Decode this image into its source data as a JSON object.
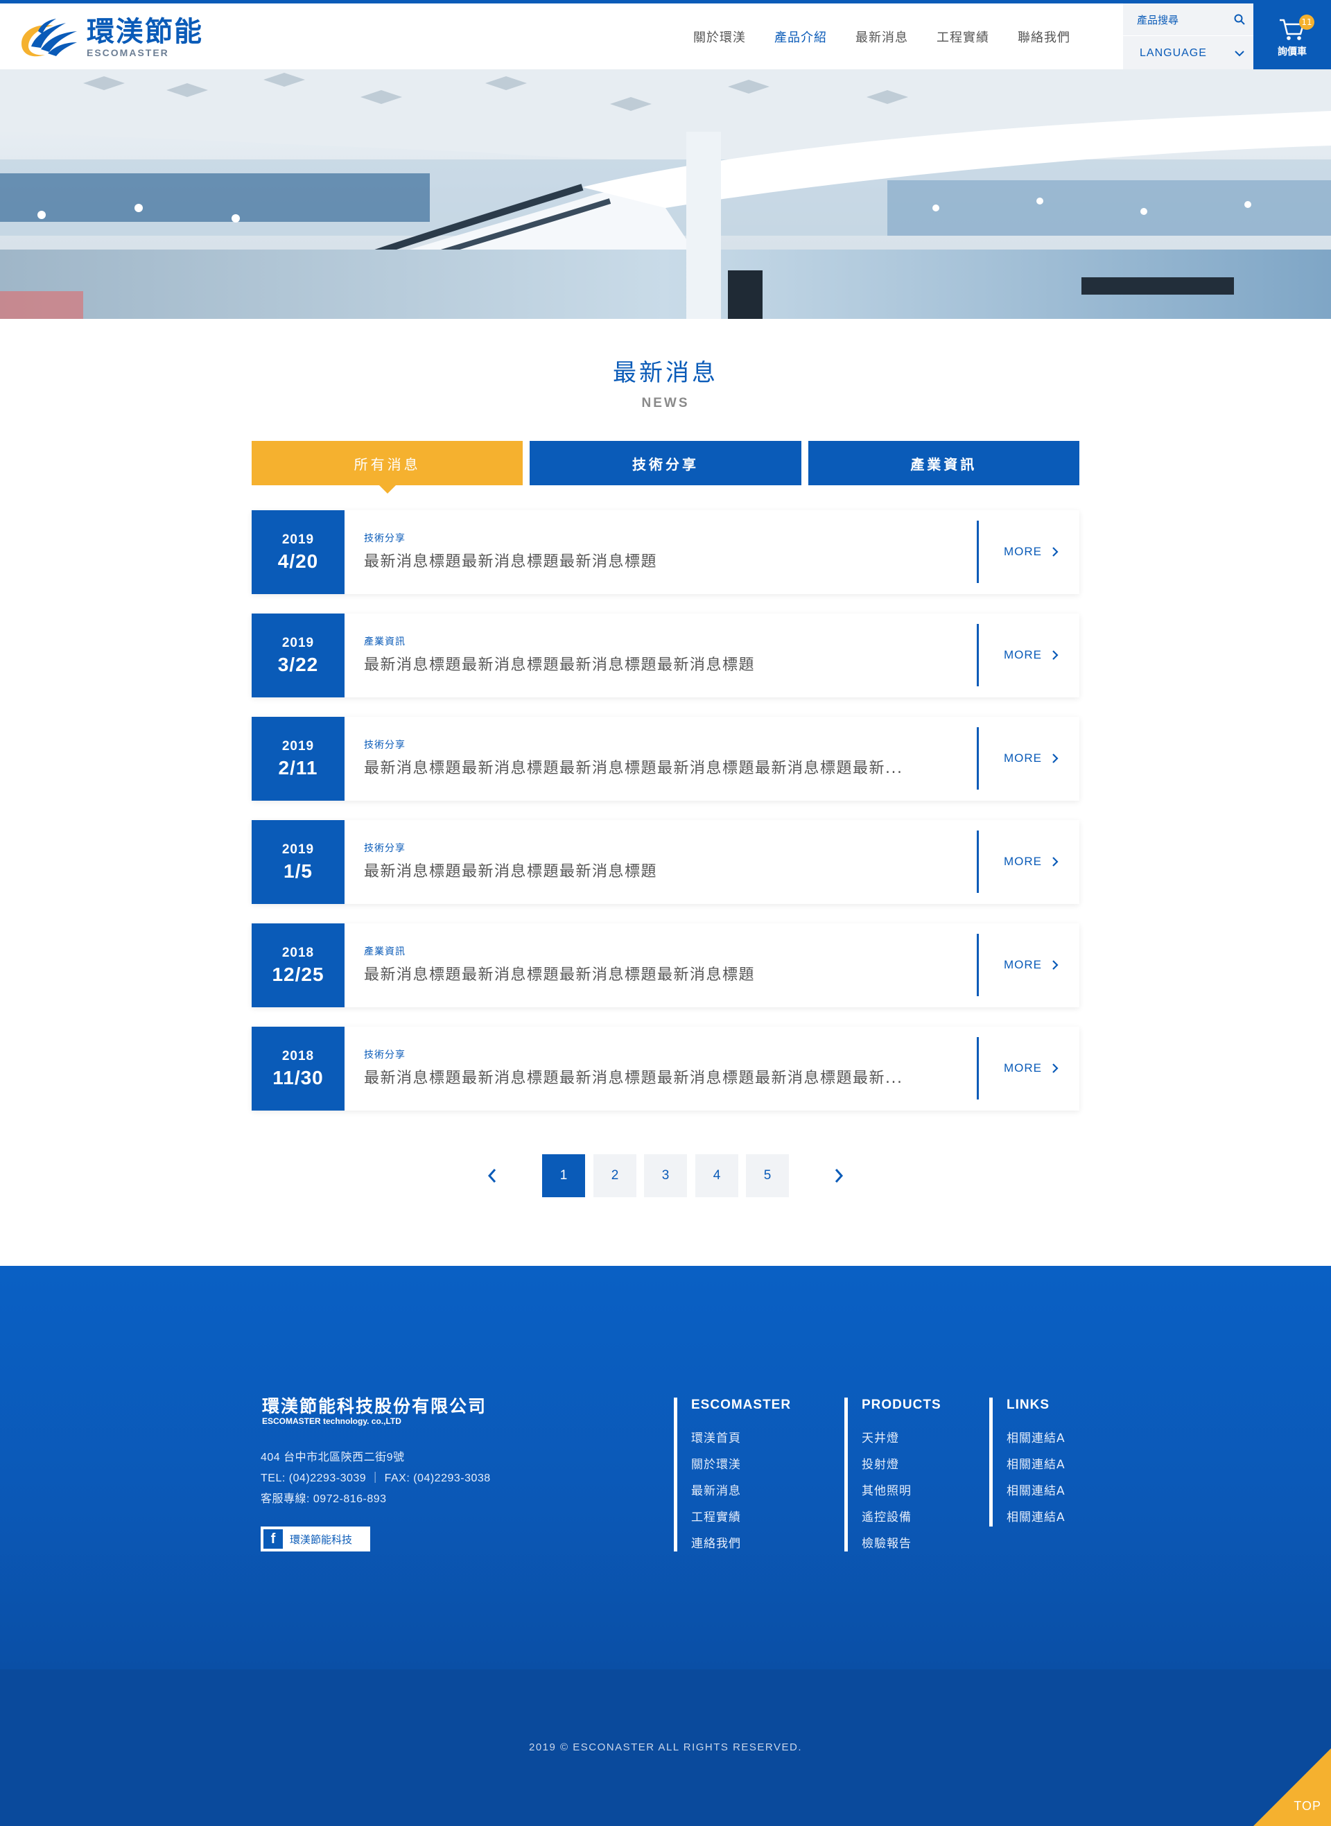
{
  "header": {
    "logo_cn": "環渼節能",
    "logo_en": "ESCOMASTER",
    "nav": [
      {
        "label": "關於環渼",
        "active": false
      },
      {
        "label": "產品介紹",
        "active": true
      },
      {
        "label": "最新消息",
        "active": false
      },
      {
        "label": "工程實績",
        "active": false
      },
      {
        "label": "聯絡我們",
        "active": false
      }
    ],
    "search_label": "產品搜尋",
    "language_label": "LANGUAGE",
    "cart_count": "11",
    "cart_label": "詢價車"
  },
  "section": {
    "title_cn": "最新消息",
    "title_en": "NEWS"
  },
  "tabs": [
    {
      "label": "所有消息",
      "active": true
    },
    {
      "label": "技術分享",
      "active": false
    },
    {
      "label": "產業資訊",
      "active": false
    }
  ],
  "news": [
    {
      "year": "2019",
      "md": "4/20",
      "category": "技術分享",
      "title": "最新消息標題最新消息標題最新消息標題",
      "more": "MORE"
    },
    {
      "year": "2019",
      "md": "3/22",
      "category": "產業資訊",
      "title": "最新消息標題最新消息標題最新消息標題最新消息標題",
      "more": "MORE"
    },
    {
      "year": "2019",
      "md": "2/11",
      "category": "技術分享",
      "title": "最新消息標題最新消息標題最新消息標題最新消息標題最新消息標題最新...",
      "more": "MORE"
    },
    {
      "year": "2019",
      "md": "1/5",
      "category": "技術分享",
      "title": "最新消息標題最新消息標題最新消息標題",
      "more": "MORE"
    },
    {
      "year": "2018",
      "md": "12/25",
      "category": "產業資訊",
      "title": "最新消息標題最新消息標題最新消息標題最新消息標題",
      "more": "MORE"
    },
    {
      "year": "2018",
      "md": "11/30",
      "category": "技術分享",
      "title": "最新消息標題最新消息標題最新消息標題最新消息標題最新消息標題最新...",
      "more": "MORE"
    }
  ],
  "pagination": {
    "pages": [
      "1",
      "2",
      "3",
      "4",
      "5"
    ],
    "current": "1"
  },
  "footer": {
    "company_cn": "環渼節能科技股份有限公司",
    "company_en": "ESCOMASTER technology. co.,LTD",
    "address": "404 台中市北區陝西二街9號",
    "tel_fax": "TEL: (04)2293-3039 ｜ FAX: (04)2293-3038",
    "hotline": "客服專線: 0972-816-893",
    "facebook_label": "環渼節能科技",
    "columns": [
      {
        "title": "ESCOMASTER",
        "links": [
          "環渼首頁",
          "關於環渼",
          "最新消息",
          "工程實績",
          "連絡我們"
        ]
      },
      {
        "title": "PRODUCTS",
        "links": [
          "天井燈",
          "投射燈",
          "其他照明",
          "遙控設備",
          "檢驗報告"
        ]
      },
      {
        "title": "LINKS",
        "links": [
          "相關連結A",
          "相關連結A",
          "相關連結A",
          "相關連結A"
        ]
      }
    ],
    "copyright": "2019 © ESCONASTER ALL RIGHTS RESERVED.",
    "top_label": "TOP"
  },
  "colors": {
    "brand_blue": "#0a5bb8",
    "accent_yellow": "#f5b12f"
  },
  "icons": [
    "logo-mark",
    "search-icon",
    "chevron-down-icon",
    "cart-icon",
    "chevron-right-icon",
    "chevron-left-icon",
    "facebook-icon"
  ]
}
